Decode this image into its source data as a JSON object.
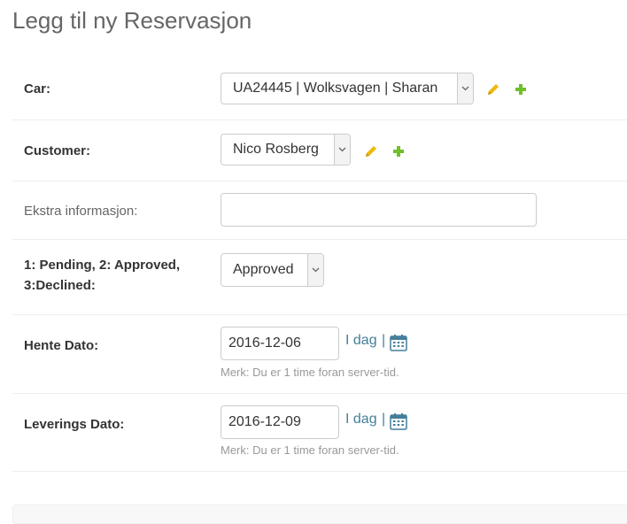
{
  "page": {
    "title": "Legg til ny Reservasjon"
  },
  "fields": {
    "car": {
      "label": "Car:",
      "value": "UA24445 | Wolksvagen | Sharan",
      "edit_icon": "pencil-icon",
      "add_icon": "plus-icon"
    },
    "customer": {
      "label": "Customer:",
      "value": "Nico Rosberg",
      "edit_icon": "pencil-icon",
      "add_icon": "plus-icon"
    },
    "extra_info": {
      "label": "Ekstra informasjon:",
      "value": ""
    },
    "status": {
      "label_line1": "1: Pending, 2: Approved,",
      "label_line2": "3:Declined:",
      "value": "Approved"
    },
    "pickup_date": {
      "label": "Hente Dato:",
      "value": "2016-12-06",
      "today_link": "I dag",
      "separator": "|",
      "calendar_icon": "calendar-icon",
      "help": "Merk: Du er 1 time foran server-tid."
    },
    "delivery_date": {
      "label": "Leverings Dato:",
      "value": "2016-12-09",
      "today_link": "I dag",
      "separator": "|",
      "calendar_icon": "calendar-icon",
      "help": "Merk: Du er 1 time foran server-tid."
    }
  },
  "colors": {
    "accent_link": "#447e9b",
    "edit_icon": "#efb80b",
    "add_icon": "#70bf2b"
  }
}
